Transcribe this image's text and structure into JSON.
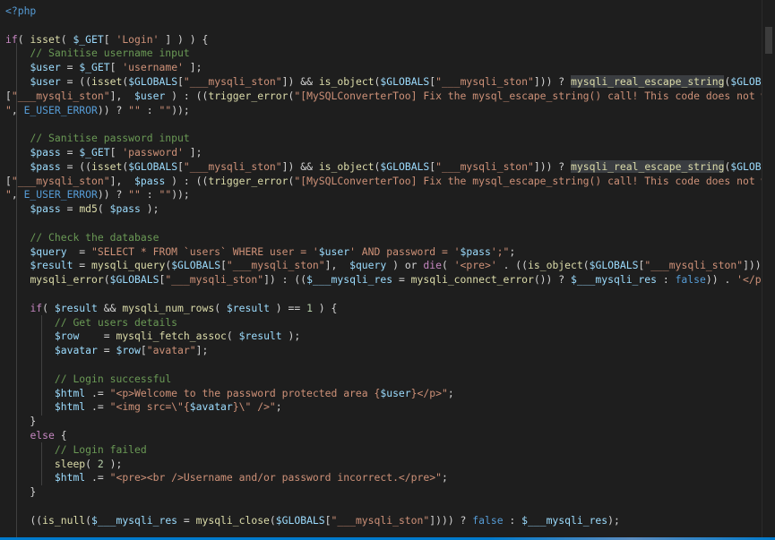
{
  "editor": {
    "language": "php",
    "colors": {
      "background": "#1e1e1e",
      "default": "#d4d4d4",
      "keyword": "#c586c0",
      "variable": "#9cdcfe",
      "function": "#dcdcaa",
      "string": "#ce9178",
      "comment": "#6a9955",
      "number": "#b5cea8",
      "php_tag": "#569cd6",
      "constant": "#569cd6",
      "selection_highlight": "#3a3d41"
    },
    "lines": [
      [
        [
          "<?php",
          "php"
        ]
      ],
      [],
      [
        [
          "if",
          "kw"
        ],
        [
          "( ",
          "d"
        ],
        [
          "isset",
          "fn"
        ],
        [
          "( ",
          "d"
        ],
        [
          "$_GET",
          "var"
        ],
        [
          "[ ",
          "d"
        ],
        [
          "'Login'",
          "str"
        ],
        [
          " ] ) ) {",
          "d"
        ]
      ],
      [
        [
          "    ",
          "d"
        ],
        [
          "// Sanitise username input",
          "cm"
        ]
      ],
      [
        [
          "    ",
          "d"
        ],
        [
          "$user",
          "var"
        ],
        [
          " = ",
          "d"
        ],
        [
          "$_GET",
          "var"
        ],
        [
          "[ ",
          "d"
        ],
        [
          "'username'",
          "str"
        ],
        [
          " ];",
          "d"
        ]
      ],
      [
        [
          "    ",
          "d"
        ],
        [
          "$user",
          "var"
        ],
        [
          " = ((",
          "d"
        ],
        [
          "isset",
          "fn"
        ],
        [
          "(",
          "d"
        ],
        [
          "$GLOBALS",
          "var"
        ],
        [
          "[",
          "d"
        ],
        [
          "\"___mysqli_ston\"",
          "str"
        ],
        [
          "]) && ",
          "d"
        ],
        [
          "is_object",
          "fn"
        ],
        [
          "(",
          "d"
        ],
        [
          "$GLOBALS",
          "var"
        ],
        [
          "[",
          "d"
        ],
        [
          "\"___mysqli_ston\"",
          "str"
        ],
        [
          "])) ? ",
          "d"
        ],
        [
          "mysqli_real_escape_string",
          "fnhl"
        ],
        [
          "(",
          "d"
        ],
        [
          "$GLOBALS",
          "var"
        ]
      ],
      [
        [
          "[",
          "d"
        ],
        [
          "\"___mysqli_ston\"",
          "str"
        ],
        [
          "],  ",
          "d"
        ],
        [
          "$user",
          "var"
        ],
        [
          " ) : ((",
          "d"
        ],
        [
          "trigger_error",
          "fn"
        ],
        [
          "(",
          "d"
        ],
        [
          "\"[MySQLConverterToo] Fix the mysql_escape_string() call! This code does not work.",
          "str"
        ]
      ],
      [
        [
          "\"",
          "str"
        ],
        [
          ", ",
          "d"
        ],
        [
          "E_USER_ERROR",
          "const"
        ],
        [
          ")) ? ",
          "d"
        ],
        [
          "\"\"",
          "str"
        ],
        [
          " : ",
          "d"
        ],
        [
          "\"\"",
          "str"
        ],
        [
          "));",
          "d"
        ]
      ],
      [],
      [
        [
          "    ",
          "d"
        ],
        [
          "// Sanitise password input",
          "cm"
        ]
      ],
      [
        [
          "    ",
          "d"
        ],
        [
          "$pass",
          "var"
        ],
        [
          " = ",
          "d"
        ],
        [
          "$_GET",
          "var"
        ],
        [
          "[ ",
          "d"
        ],
        [
          "'password'",
          "str"
        ],
        [
          " ];",
          "d"
        ]
      ],
      [
        [
          "    ",
          "d"
        ],
        [
          "$pass",
          "var"
        ],
        [
          " = ((",
          "d"
        ],
        [
          "isset",
          "fn"
        ],
        [
          "(",
          "d"
        ],
        [
          "$GLOBALS",
          "var"
        ],
        [
          "[",
          "d"
        ],
        [
          "\"___mysqli_ston\"",
          "str"
        ],
        [
          "]) && ",
          "d"
        ],
        [
          "is_object",
          "fn"
        ],
        [
          "(",
          "d"
        ],
        [
          "$GLOBALS",
          "var"
        ],
        [
          "[",
          "d"
        ],
        [
          "\"___mysqli_ston\"",
          "str"
        ],
        [
          "])) ? ",
          "d"
        ],
        [
          "mysqli_real_escape_string",
          "fnhl"
        ],
        [
          "(",
          "d"
        ],
        [
          "$GLOBALS",
          "var"
        ]
      ],
      [
        [
          "[",
          "d"
        ],
        [
          "\"___mysqli_ston\"",
          "str"
        ],
        [
          "],  ",
          "d"
        ],
        [
          "$pass",
          "var"
        ],
        [
          " ) : ((",
          "d"
        ],
        [
          "trigger_error",
          "fn"
        ],
        [
          "(",
          "d"
        ],
        [
          "\"[MySQLConverterToo] Fix the mysql_escape_string() call! This code does not work.",
          "str"
        ]
      ],
      [
        [
          "\"",
          "str"
        ],
        [
          ", ",
          "d"
        ],
        [
          "E_USER_ERROR",
          "const"
        ],
        [
          ")) ? ",
          "d"
        ],
        [
          "\"\"",
          "str"
        ],
        [
          " : ",
          "d"
        ],
        [
          "\"\"",
          "str"
        ],
        [
          "));",
          "d"
        ]
      ],
      [
        [
          "    ",
          "d"
        ],
        [
          "$pass",
          "var"
        ],
        [
          " = ",
          "d"
        ],
        [
          "md5",
          "fn"
        ],
        [
          "( ",
          "d"
        ],
        [
          "$pass",
          "var"
        ],
        [
          " );",
          "d"
        ]
      ],
      [],
      [
        [
          "    ",
          "d"
        ],
        [
          "// Check the database",
          "cm"
        ]
      ],
      [
        [
          "    ",
          "d"
        ],
        [
          "$query",
          "var"
        ],
        [
          "  = ",
          "d"
        ],
        [
          "\"SELECT * FROM `users` WHERE user = '",
          "str"
        ],
        [
          "$user",
          "var"
        ],
        [
          "' AND password = '",
          "str"
        ],
        [
          "$pass",
          "var"
        ],
        [
          "';\"",
          "str"
        ],
        [
          ";",
          "d"
        ]
      ],
      [
        [
          "    ",
          "d"
        ],
        [
          "$result",
          "var"
        ],
        [
          " = ",
          "d"
        ],
        [
          "mysqli_query",
          "fn"
        ],
        [
          "(",
          "d"
        ],
        [
          "$GLOBALS",
          "var"
        ],
        [
          "[",
          "d"
        ],
        [
          "\"___mysqli_ston\"",
          "str"
        ],
        [
          "],  ",
          "d"
        ],
        [
          "$query",
          "var"
        ],
        [
          " ) or ",
          "d"
        ],
        [
          "die",
          "kw"
        ],
        [
          "( ",
          "d"
        ],
        [
          "'<pre>'",
          "str"
        ],
        [
          " . ((",
          "d"
        ],
        [
          "is_object",
          "fn"
        ],
        [
          "(",
          "d"
        ],
        [
          "$GLOBALS",
          "var"
        ],
        [
          "[",
          "d"
        ],
        [
          "\"___mysqli_ston\"",
          "str"
        ],
        [
          "])) ?",
          "d"
        ]
      ],
      [
        [
          "    ",
          "d"
        ],
        [
          "mysqli_error",
          "fn"
        ],
        [
          "(",
          "d"
        ],
        [
          "$GLOBALS",
          "var"
        ],
        [
          "[",
          "d"
        ],
        [
          "\"___mysqli_ston\"",
          "str"
        ],
        [
          "]) : ((",
          "d"
        ],
        [
          "$___mysqli_res",
          "var"
        ],
        [
          " = ",
          "d"
        ],
        [
          "mysqli_connect_error",
          "fn"
        ],
        [
          "()) ? ",
          "d"
        ],
        [
          "$___mysqli_res",
          "var"
        ],
        [
          " : ",
          "d"
        ],
        [
          "false",
          "const"
        ],
        [
          ")) . ",
          "d"
        ],
        [
          "'</pre>'",
          "str"
        ],
        [
          " );",
          "d"
        ]
      ],
      [],
      [
        [
          "    ",
          "d"
        ],
        [
          "if",
          "kw"
        ],
        [
          "( ",
          "d"
        ],
        [
          "$result",
          "var"
        ],
        [
          " && ",
          "d"
        ],
        [
          "mysqli_num_rows",
          "fn"
        ],
        [
          "( ",
          "d"
        ],
        [
          "$result",
          "var"
        ],
        [
          " ) == ",
          "d"
        ],
        [
          "1",
          "num"
        ],
        [
          " ) {",
          "d"
        ]
      ],
      [
        [
          "        ",
          "d"
        ],
        [
          "// Get users details",
          "cm"
        ]
      ],
      [
        [
          "        ",
          "d"
        ],
        [
          "$row",
          "var"
        ],
        [
          "    = ",
          "d"
        ],
        [
          "mysqli_fetch_assoc",
          "fn"
        ],
        [
          "( ",
          "d"
        ],
        [
          "$result",
          "var"
        ],
        [
          " );",
          "d"
        ]
      ],
      [
        [
          "        ",
          "d"
        ],
        [
          "$avatar",
          "var"
        ],
        [
          " = ",
          "d"
        ],
        [
          "$row",
          "var"
        ],
        [
          "[",
          "d"
        ],
        [
          "\"avatar\"",
          "str"
        ],
        [
          "];",
          "d"
        ]
      ],
      [],
      [
        [
          "        ",
          "d"
        ],
        [
          "// Login successful",
          "cm"
        ]
      ],
      [
        [
          "        ",
          "d"
        ],
        [
          "$html",
          "var"
        ],
        [
          " .= ",
          "d"
        ],
        [
          "\"<p>Welcome to the password protected area {",
          "str"
        ],
        [
          "$user",
          "var"
        ],
        [
          "}</p>\"",
          "str"
        ],
        [
          ";",
          "d"
        ]
      ],
      [
        [
          "        ",
          "d"
        ],
        [
          "$html",
          "var"
        ],
        [
          " .= ",
          "d"
        ],
        [
          "\"<img src=\\\"{",
          "str"
        ],
        [
          "$avatar",
          "var"
        ],
        [
          "}\\\" />\"",
          "str"
        ],
        [
          ";",
          "d"
        ]
      ],
      [
        [
          "    }",
          "d"
        ]
      ],
      [
        [
          "    ",
          "d"
        ],
        [
          "else",
          "kw"
        ],
        [
          " {",
          "d"
        ]
      ],
      [
        [
          "        ",
          "d"
        ],
        [
          "// Login failed",
          "cm"
        ]
      ],
      [
        [
          "        ",
          "d"
        ],
        [
          "sleep",
          "fn"
        ],
        [
          "( ",
          "d"
        ],
        [
          "2",
          "num"
        ],
        [
          " );",
          "d"
        ]
      ],
      [
        [
          "        ",
          "d"
        ],
        [
          "$html",
          "var"
        ],
        [
          " .= ",
          "d"
        ],
        [
          "\"<pre><br />Username and/or password incorrect.</pre>\"",
          "str"
        ],
        [
          ";",
          "d"
        ]
      ],
      [
        [
          "    }",
          "d"
        ]
      ],
      [],
      [
        [
          "    ",
          "d"
        ],
        [
          "((",
          "d"
        ],
        [
          "is_null",
          "fn"
        ],
        [
          "(",
          "d"
        ],
        [
          "$___mysqli_res",
          "var"
        ],
        [
          " = ",
          "d"
        ],
        [
          "mysqli_close",
          "fn"
        ],
        [
          "(",
          "d"
        ],
        [
          "$GLOBALS",
          "var"
        ],
        [
          "[",
          "d"
        ],
        [
          "\"___mysqli_ston\"",
          "str"
        ],
        [
          "]))) ? ",
          "d"
        ],
        [
          "false",
          "const"
        ],
        [
          " : ",
          "d"
        ],
        [
          "$___mysqli_res",
          "var"
        ],
        [
          ");",
          "d"
        ]
      ]
    ]
  }
}
